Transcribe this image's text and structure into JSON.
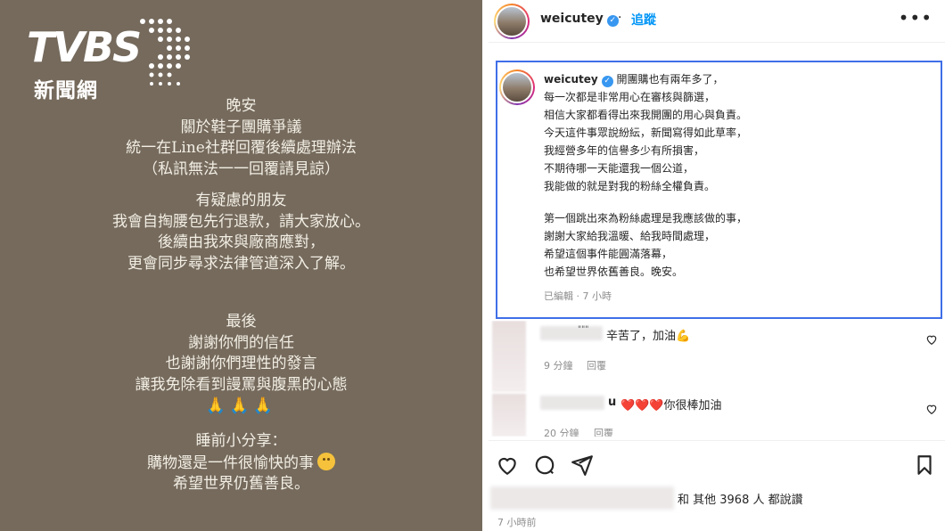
{
  "story": {
    "logo_main": "TVBS",
    "logo_sub": "新聞網",
    "block1": [
      "晚安",
      "關於鞋子團購爭議",
      "統一在Line社群回覆後續處理辦法",
      "（私訊無法一一回覆請見諒）"
    ],
    "block2": [
      "有疑慮的朋友",
      "我會自掏腰包先行退款，請大家放心。",
      "後續由我來與廠商應對，",
      "更會同步尋求法律管道深入了解。"
    ],
    "block3": [
      "最後",
      "謝謝你們的信任",
      "也謝謝你們理性的發言",
      "讓我免除看到謾罵與腹黑的心態"
    ],
    "pray_icon": "🙏🙏🙏",
    "block4": [
      "睡前小分享：",
      "購物還是一件很愉快的事",
      "希望世界仍舊善良。"
    ]
  },
  "post": {
    "username": "weicutey",
    "follow_label": "追蹤",
    "more_label": "•••",
    "caption_lines": [
      "開團購也有兩年多了，",
      "每一次都是非常用心在審核與篩選，",
      "相信大家都看得出來我開團的用心與負責。",
      "今天這件事眾說紛紜，新聞寫得如此草率，",
      "我經營多年的信譽多少有所損害，",
      "不期待哪一天能還我一個公道，",
      "我能做的就是對我的粉絲全權負責。",
      "",
      "第一個跳出來為粉絲處理是我應該做的事，",
      "謝謝大家給我溫暖、給我時間處理，",
      "希望這個事件能圓滿落幕，",
      "也希望世界依舊善良。晚安。"
    ],
    "caption_meta": "已編輯 · 7 小時",
    "comments": [
      {
        "name_suffix": "\"\"\"",
        "text": "辛苦了，加油💪",
        "meta_time": "9 分鐘",
        "meta_reply": "回覆"
      },
      {
        "name_suffix": "u",
        "text": "❤️❤️❤️你很棒加油",
        "meta_time": "20 分鐘",
        "meta_reply": "回覆"
      }
    ],
    "likes_text": "和 其他 3968 人 都說讚",
    "time_ago": "7 小時前"
  }
}
